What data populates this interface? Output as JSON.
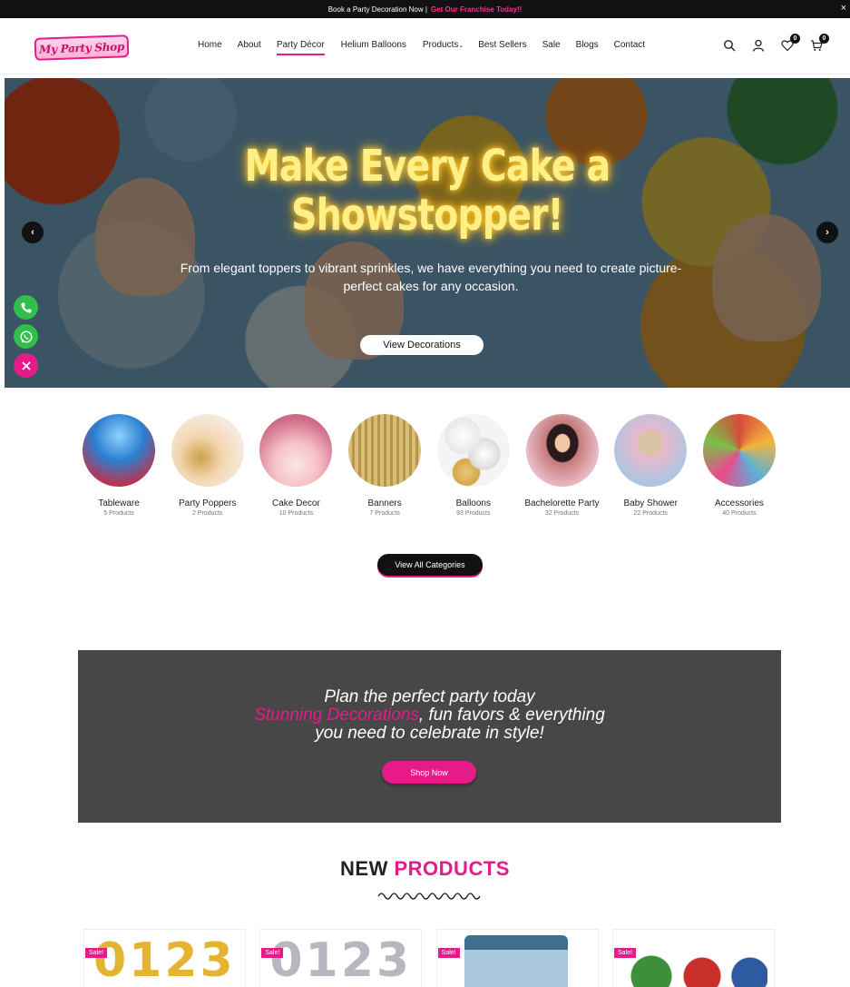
{
  "topbar": {
    "text": "Book a Party Decoration Now |",
    "link": "Get Our Franchise Today!!",
    "close": "×"
  },
  "logo": {
    "text": "My Party Shop"
  },
  "nav": [
    "Home",
    "About",
    "Party Décor",
    "Helium Balloons",
    "Products",
    "Best Sellers",
    "Sale",
    "Blogs",
    "Contact"
  ],
  "nav_caret": "⌄",
  "header_icons": {
    "wishlist_count": "0",
    "cart_count": "0"
  },
  "hero": {
    "title_line1": "Make Every Cake a",
    "title_line2": "Showstopper!",
    "subtitle": "From elegant toppers to vibrant sprinkles, we have everything you need to create picture-perfect cakes for any occasion.",
    "button": "View Decorations",
    "prev": "‹",
    "next": "›"
  },
  "categories": [
    {
      "name": "Tableware",
      "count": "5 Products",
      "color": "#2b7fd0"
    },
    {
      "name": "Party Poppers",
      "count": "2 Products",
      "color": "#e9b44c"
    },
    {
      "name": "Cake Decor",
      "count": "10 Products",
      "color": "#d86a8c"
    },
    {
      "name": "Banners",
      "count": "7 Products",
      "color": "#c8a85a"
    },
    {
      "name": "Balloons",
      "count": "93 Products",
      "color": "#d8d8d8"
    },
    {
      "name": "Bachelorette Party",
      "count": "32 Products",
      "color": "#7a4a4a"
    },
    {
      "name": "Baby Shower",
      "count": "22 Products",
      "color": "#e6b3c8"
    },
    {
      "name": "Accessories",
      "count": "40 Products",
      "color": "#d64b3a"
    }
  ],
  "view_all": "View All Categories",
  "promo": {
    "line1": "Plan the perfect party today",
    "line2_pink": "Stunning Decorations",
    "line2_rest": ", fun favors & everything",
    "line3": "you need to celebrate in style!",
    "button": "Shop Now"
  },
  "new_products": {
    "title_black": "NEW",
    "title_pink": "PRODUCTS",
    "items": [
      {
        "sale": "Sale!",
        "digits": "0123",
        "color": "#e4b330"
      },
      {
        "sale": "Sale!",
        "digits": "0123",
        "color": "#b7b7bf"
      },
      {
        "sale": "Sale!",
        "digits": "",
        "color": "#5b8fb5"
      },
      {
        "sale": "Sale!",
        "digits": "",
        "color": "#3d8f3a"
      }
    ]
  },
  "colors": {
    "brand_pink": "#e61b8a",
    "dark": "#111111",
    "promo_bg": "#474747"
  }
}
